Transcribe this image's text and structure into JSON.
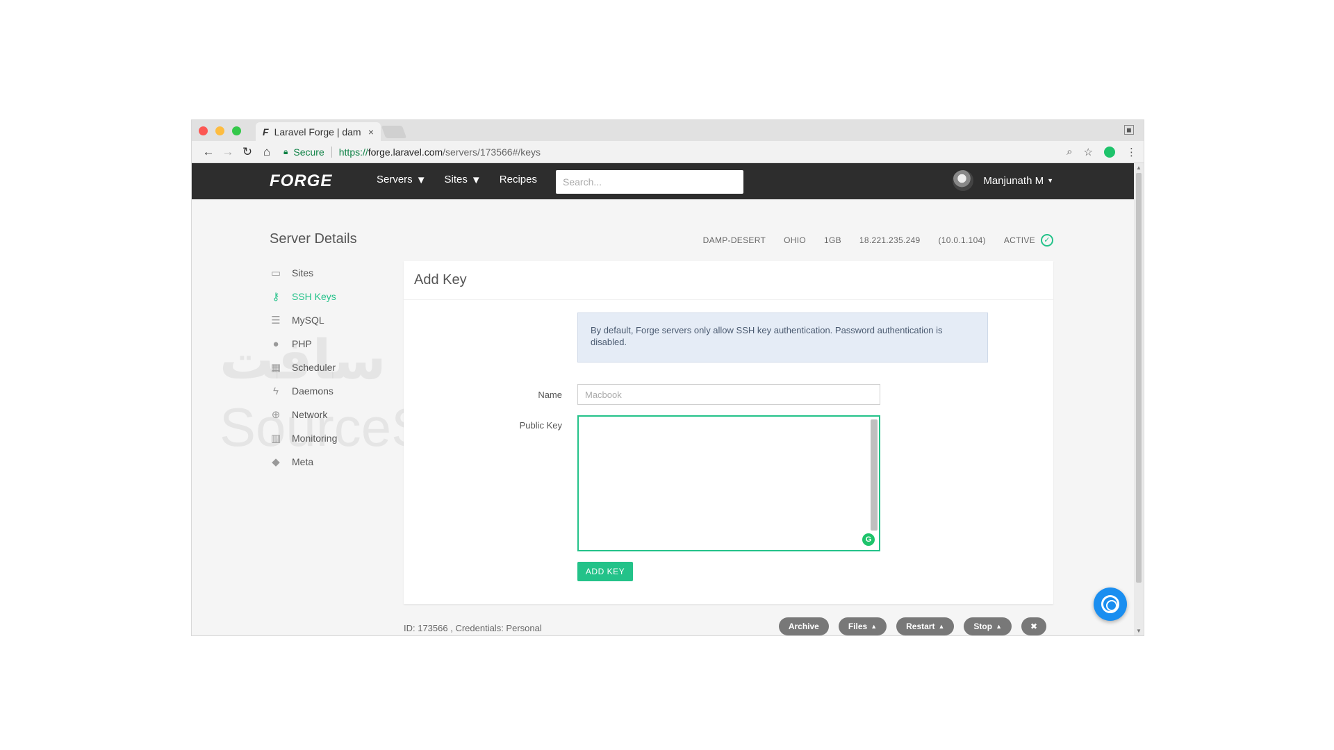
{
  "browser": {
    "tab_title": "Laravel Forge | dam",
    "tab_favicon": "F",
    "tab_close": "×",
    "secure_label": "Secure",
    "url_scheme": "https://",
    "url_host": "forge.laravel.com",
    "url_path": "/servers/173566#/keys",
    "traffic_colors": {
      "close": "#fc5753",
      "minimize": "#fdbc40",
      "maximize": "#34c84a"
    }
  },
  "nav": {
    "logo": "FORGE",
    "menu": [
      {
        "label": "Servers",
        "caret": true
      },
      {
        "label": "Sites",
        "caret": true
      },
      {
        "label": "Recipes",
        "caret": false
      }
    ],
    "search_placeholder": "Search...",
    "user_name": "Manjunath M",
    "bg_color": "#2d2d2d"
  },
  "server": {
    "title": "Server Details",
    "name": "DAMP-DESERT",
    "region": "OHIO",
    "size": "1GB",
    "public_ip": "18.221.235.249",
    "private_ip": "(10.0.1.104)",
    "status": "ACTIVE"
  },
  "sidebar": {
    "items": [
      {
        "label": "Sites",
        "icon": "window-icon",
        "active": false
      },
      {
        "label": "SSH Keys",
        "icon": "key-icon",
        "active": true
      },
      {
        "label": "MySQL",
        "icon": "database-icon",
        "active": false
      },
      {
        "label": "PHP",
        "icon": "php-icon",
        "active": false
      },
      {
        "label": "Scheduler",
        "icon": "calendar-icon",
        "active": false
      },
      {
        "label": "Daemons",
        "icon": "bolt-icon",
        "active": false
      },
      {
        "label": "Network",
        "icon": "globe-icon",
        "active": false
      },
      {
        "label": "Monitoring",
        "icon": "bar-chart-icon",
        "active": false
      },
      {
        "label": "Meta",
        "icon": "tag-icon",
        "active": false
      }
    ],
    "accent_color": "#23c289"
  },
  "add_key": {
    "title": "Add Key",
    "alert": "By default, Forge servers only allow SSH key authentication. Password authentication is disabled.",
    "name_label": "Name",
    "name_placeholder": "Macbook",
    "public_key_label": "Public Key",
    "public_key_value": "",
    "submit_label": "ADD KEY"
  },
  "footer": {
    "info": "ID: 173566 , Credentials: Personal",
    "actions": [
      {
        "label": "Archive",
        "caret": false
      },
      {
        "label": "Files",
        "caret": true
      },
      {
        "label": "Restart",
        "caret": true
      },
      {
        "label": "Stop",
        "caret": true
      }
    ],
    "close_label": "✖"
  },
  "watermark": {
    "arabic": "سورس سافت",
    "latin": "SourceSoft"
  }
}
